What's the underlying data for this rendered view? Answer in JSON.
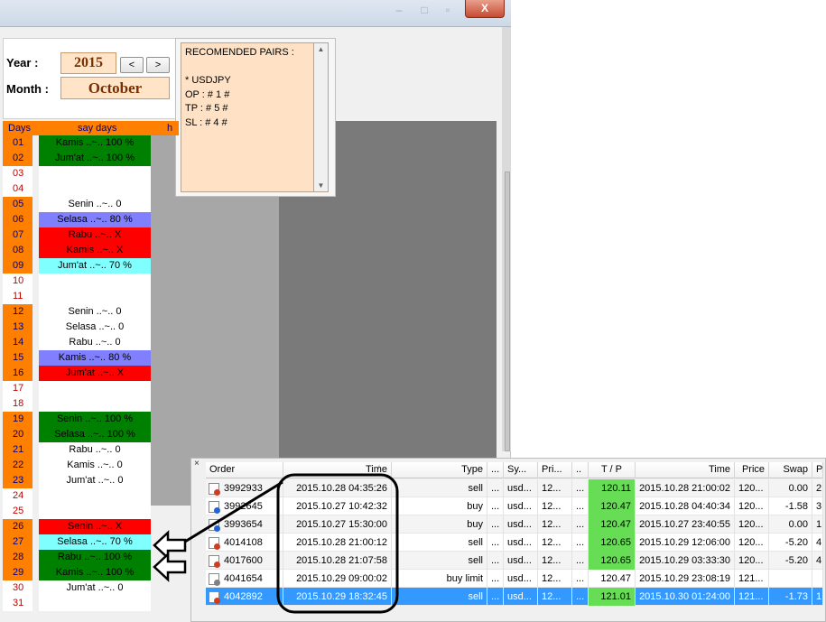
{
  "window": {
    "close_label": "X"
  },
  "calendar": {
    "year_label": "Year :",
    "year_value": "2015",
    "prev_label": "<",
    "next_label": ">",
    "month_label": "Month :",
    "month_value": "October"
  },
  "recommended": {
    "lines": [
      "RECOMENDED PAIRS :",
      "",
      "* USDJPY",
      "OP : # 1 #",
      "TP : # 5 #",
      "SL : # 4 #"
    ],
    "scroll_up": "▲",
    "scroll_down": "▼"
  },
  "days_table": {
    "headers": [
      "Days",
      "say days",
      "h"
    ],
    "rows": [
      {
        "day": "01",
        "desc": "Kamis ..~.. 100 %",
        "color": "#008000",
        "weekday": true
      },
      {
        "day": "02",
        "desc": "Jum'at ..~.. 100 %",
        "color": "#008000",
        "weekday": true
      },
      {
        "day": "03",
        "desc": "",
        "color": "#ffffff",
        "weekday": false
      },
      {
        "day": "04",
        "desc": "",
        "color": "#ffffff",
        "weekday": false
      },
      {
        "day": "05",
        "desc": "Senin ..~.. 0",
        "color": "#ffffff",
        "weekday": true
      },
      {
        "day": "06",
        "desc": "Selasa ..~.. 80 %",
        "color": "#8080ff",
        "weekday": true
      },
      {
        "day": "07",
        "desc": "Rabu ..~.. X",
        "color": "#ff0000",
        "weekday": true
      },
      {
        "day": "08",
        "desc": "Kamis ..~.. X",
        "color": "#ff0000",
        "weekday": true
      },
      {
        "day": "09",
        "desc": "Jum'at ..~.. 70 %",
        "color": "#80ffff",
        "weekday": true
      },
      {
        "day": "10",
        "desc": "",
        "color": "#ffffff",
        "weekday": false
      },
      {
        "day": "11",
        "desc": "",
        "color": "#ffffff",
        "weekday": false
      },
      {
        "day": "12",
        "desc": "Senin ..~.. 0",
        "color": "#ffffff",
        "weekday": true
      },
      {
        "day": "13",
        "desc": "Selasa ..~.. 0",
        "color": "#ffffff",
        "weekday": true
      },
      {
        "day": "14",
        "desc": "Rabu ..~.. 0",
        "color": "#ffffff",
        "weekday": true
      },
      {
        "day": "15",
        "desc": "Kamis ..~.. 80 %",
        "color": "#8080ff",
        "weekday": true
      },
      {
        "day": "16",
        "desc": "Jum'at ..~.. X",
        "color": "#ff0000",
        "weekday": true
      },
      {
        "day": "17",
        "desc": "",
        "color": "#ffffff",
        "weekday": false
      },
      {
        "day": "18",
        "desc": "",
        "color": "#ffffff",
        "weekday": false
      },
      {
        "day": "19",
        "desc": "Senin ..~.. 100 %",
        "color": "#008000",
        "weekday": true
      },
      {
        "day": "20",
        "desc": "Selasa ..~.. 100 %",
        "color": "#008000",
        "weekday": true
      },
      {
        "day": "21",
        "desc": "Rabu ..~.. 0",
        "color": "#ffffff",
        "weekday": true
      },
      {
        "day": "22",
        "desc": "Kamis ..~.. 0",
        "color": "#ffffff",
        "weekday": true
      },
      {
        "day": "23",
        "desc": "Jum'at ..~.. 0",
        "color": "#ffffff",
        "weekday": true
      },
      {
        "day": "24",
        "desc": "",
        "color": "#ffffff",
        "weekday": false
      },
      {
        "day": "25",
        "desc": "",
        "color": "#ffffff",
        "weekday": false
      },
      {
        "day": "26",
        "desc": "Senin ..~.. X",
        "color": "#ff0000",
        "weekday": true
      },
      {
        "day": "27",
        "desc": "Selasa ..~.. 70 %",
        "color": "#80ffff",
        "weekday": true
      },
      {
        "day": "28",
        "desc": "Rabu ..~.. 100 %",
        "color": "#008000",
        "weekday": true
      },
      {
        "day": "29",
        "desc": "Kamis ..~.. 100 %",
        "color": "#008000",
        "weekday": true
      },
      {
        "day": "30",
        "desc": "Jum'at ..~.. 0",
        "color": "#ffffff",
        "weekday": false
      },
      {
        "day": "31",
        "desc": "",
        "color": "#ffffff",
        "weekday": false
      }
    ]
  },
  "terminal": {
    "close_label": "×",
    "columns": [
      "Order",
      "Time",
      "Type",
      "...",
      "Sy...",
      "Pri...",
      "..",
      "T / P",
      "Time",
      "Price",
      "Swap",
      "P..."
    ],
    "sort_indicator": "/",
    "rows": [
      {
        "order": "3992933",
        "time": "2015.10.28 04:35:26",
        "type": "sell",
        "c4": "...",
        "sym": "usd...",
        "price": "12...",
        "c7": "...",
        "tp": "120.11",
        "tp_hit": true,
        "close_time": "2015.10.28 21:00:02",
        "close_price": "120...",
        "swap": "0.00",
        "profit": "2...",
        "dot": "#d23c1e"
      },
      {
        "order": "3992645",
        "time": "2015.10.27 10:42:32",
        "type": "buy",
        "c4": "...",
        "sym": "usd...",
        "price": "12...",
        "c7": "...",
        "tp": "120.47",
        "tp_hit": true,
        "close_time": "2015.10.28 04:40:34",
        "close_price": "120...",
        "swap": "-1.58",
        "profit": "3...",
        "dot": "#1e64d2"
      },
      {
        "order": "3993654",
        "time": "2015.10.27 15:30:00",
        "type": "buy",
        "c4": "...",
        "sym": "usd...",
        "price": "12...",
        "c7": "...",
        "tp": "120.47",
        "tp_hit": true,
        "close_time": "2015.10.27 23:40:55",
        "close_price": "120...",
        "swap": "0.00",
        "profit": "1...",
        "dot": "#1e64d2"
      },
      {
        "order": "4014108",
        "time": "2015.10.28 21:00:12",
        "type": "sell",
        "c4": "...",
        "sym": "usd...",
        "price": "12...",
        "c7": "...",
        "tp": "120.65",
        "tp_hit": true,
        "close_time": "2015.10.29 12:06:00",
        "close_price": "120...",
        "swap": "-5.20",
        "profit": "4...",
        "dot": "#d23c1e"
      },
      {
        "order": "4017600",
        "time": "2015.10.28 21:07:58",
        "type": "sell",
        "c4": "...",
        "sym": "usd...",
        "price": "12...",
        "c7": "...",
        "tp": "120.65",
        "tp_hit": true,
        "close_time": "2015.10.29 03:33:30",
        "close_price": "120...",
        "swap": "-5.20",
        "profit": "4...",
        "dot": "#d23c1e"
      },
      {
        "order": "4041654",
        "time": "2015.10.29 09:00:02",
        "type": "buy limit",
        "c4": "...",
        "sym": "usd...",
        "price": "12...",
        "c7": "...",
        "tp": "120.47",
        "tp_hit": false,
        "close_time": "2015.10.29 23:08:19",
        "close_price": "121...",
        "swap": "",
        "profit": "",
        "dot": "#808080"
      },
      {
        "order": "4042892",
        "time": "2015.10.29 18:32:45",
        "type": "sell",
        "c4": "...",
        "sym": "usd...",
        "price": "12...",
        "c7": "...",
        "tp": "121.01",
        "tp_hit": true,
        "close_time": "2015.10.30 01:24:00",
        "close_price": "121...",
        "swap": "-1.73",
        "profit": "1...",
        "dot": "#d23c1e",
        "selected": true
      }
    ]
  }
}
